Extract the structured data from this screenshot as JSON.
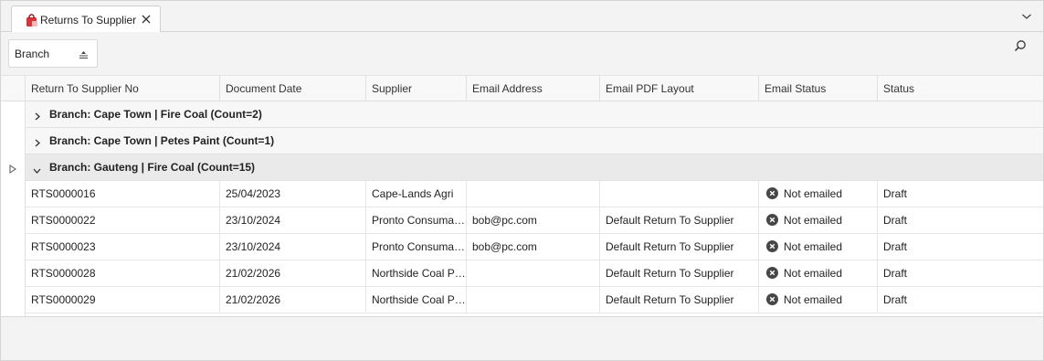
{
  "tab": {
    "title": "Returns To Supplier"
  },
  "icons": {
    "tab_icon": "red-shopping-bag-icon",
    "close": "close-icon",
    "overflow": "chevron-down-icon",
    "sort": "sort-icon",
    "search": "search-icon",
    "not_emailed": "x-circle-icon",
    "row_indicator": "triangle-right-icon",
    "collapsed": "chevron-right-icon",
    "expanded": "chevron-down-icon"
  },
  "colors": {
    "tab_icon": "#d9343a",
    "status_icon": "#4a4a4a"
  },
  "toolbar": {
    "group_chip_label": "Branch"
  },
  "columns": [
    "Return To Supplier No",
    "Document Date",
    "Supplier",
    "Email Address",
    "Email PDF Layout",
    "Email Status",
    "Status"
  ],
  "groups": [
    {
      "label": "Branch: Cape Town | Fire Coal (Count=2)",
      "expanded": false
    },
    {
      "label": "Branch: Cape Town | Petes Paint (Count=1)",
      "expanded": false
    },
    {
      "label": "Branch: Gauteng | Fire Coal (Count=15)",
      "expanded": true
    }
  ],
  "rows": [
    {
      "no": "RTS0000016",
      "date": "25/04/2023",
      "supplier": "Cape-Lands Agri",
      "email": "",
      "layout": "",
      "email_status": "Not emailed",
      "status": "Draft"
    },
    {
      "no": "RTS0000022",
      "date": "23/10/2024",
      "supplier": "Pronto Consumables",
      "email": "bob@pc.com",
      "layout": "Default Return To Supplier",
      "email_status": "Not emailed",
      "status": "Draft"
    },
    {
      "no": "RTS0000023",
      "date": "23/10/2024",
      "supplier": "Pronto Consumables",
      "email": "bob@pc.com",
      "layout": "Default Return To Supplier",
      "email_status": "Not emailed",
      "status": "Draft"
    },
    {
      "no": "RTS0000028",
      "date": "21/02/2026",
      "supplier": "Northside Coal Pro…",
      "email": "",
      "layout": "Default Return To Supplier",
      "email_status": "Not emailed",
      "status": "Draft"
    },
    {
      "no": "RTS0000029",
      "date": "21/02/2026",
      "supplier": "Northside Coal Pro…",
      "email": "",
      "layout": "Default Return To Supplier",
      "email_status": "Not emailed",
      "status": "Draft"
    }
  ]
}
